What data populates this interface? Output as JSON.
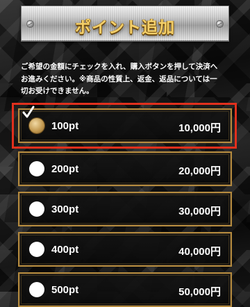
{
  "header": {
    "title": "ポイント追加"
  },
  "instructions": "ご希望の金額にチェックを入れ、購入ボタンを押して決済へお進みください。※商品の性質上、返金、返品については一切お受けできません。",
  "options": [
    {
      "points": "100pt",
      "price": "10,000円",
      "selected": true
    },
    {
      "points": "200pt",
      "price": "20,000円",
      "selected": false
    },
    {
      "points": "300pt",
      "price": "30,000円",
      "selected": false
    },
    {
      "points": "400pt",
      "price": "40,000円",
      "selected": false
    },
    {
      "points": "500pt",
      "price": "50,000円",
      "selected": false
    }
  ],
  "colors": {
    "accent_gold": "#b48a3e",
    "selection_red": "#e1301d",
    "title_gold": "#f3cf6a"
  }
}
